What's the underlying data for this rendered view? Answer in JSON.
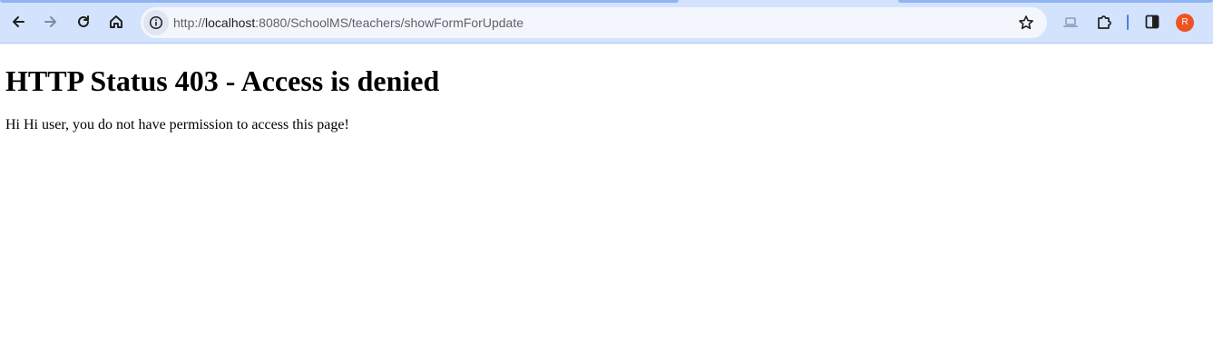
{
  "browser": {
    "url_prefix": "http://",
    "url_host": "localhost",
    "url_rest": ":8080/SchoolMS/teachers/showFormForUpdate",
    "profile_initial": "R",
    "accent_color": "#d3e3fd",
    "icons": [
      "back-arrow-icon",
      "forward-arrow-icon",
      "reload-icon",
      "home-icon",
      "info-icon",
      "star-icon",
      "laptop-icon",
      "extensions-icon",
      "side-panel-icon"
    ]
  },
  "page": {
    "heading": "HTTP Status 403 - Access is denied",
    "message": "Hi Hi user, you do not have permission to access this page!"
  }
}
